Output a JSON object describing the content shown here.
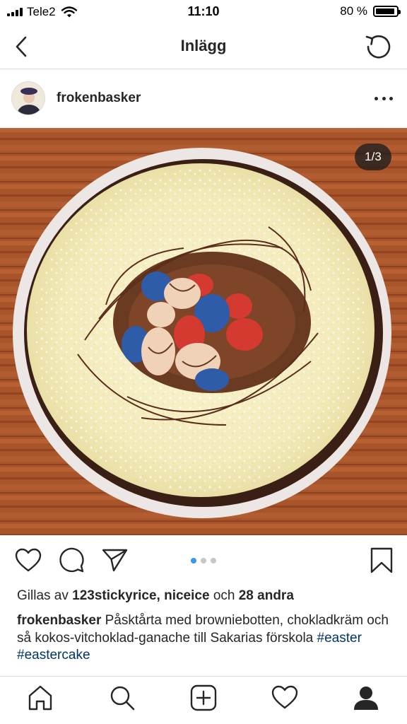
{
  "status": {
    "carrier": "Tele2",
    "time": "11:10",
    "battery": "80 %",
    "battery_level": 0.8
  },
  "nav": {
    "title": "Inlägg",
    "back_icon": "chevron-left-icon",
    "refresh_icon": "refresh-icon"
  },
  "post": {
    "username": "frokenbasker",
    "image_counter": "1/3",
    "current_slide": 1,
    "total_slides": 3,
    "likes": {
      "prefix": "Gillas av",
      "user1": "123stickyrice,",
      "user2": "niceice",
      "conj": "och",
      "others": "28 andra"
    },
    "caption": {
      "username": "frokenbasker",
      "text": "Påsktårta med browniebotten, chokladkräm och så kokos-vitchoklad-ganache till Sakarias förskola",
      "hashtags": [
        "#easter",
        "#eastercake"
      ]
    }
  },
  "tabs": [
    "home-icon",
    "search-icon",
    "add-icon",
    "activity-heart-icon",
    "profile-icon"
  ],
  "colors": {
    "hashtag": "#003569",
    "active_dot": "#3897f0",
    "inactive_dot": "#c7c7c7",
    "divider": "#dbdbdb"
  }
}
